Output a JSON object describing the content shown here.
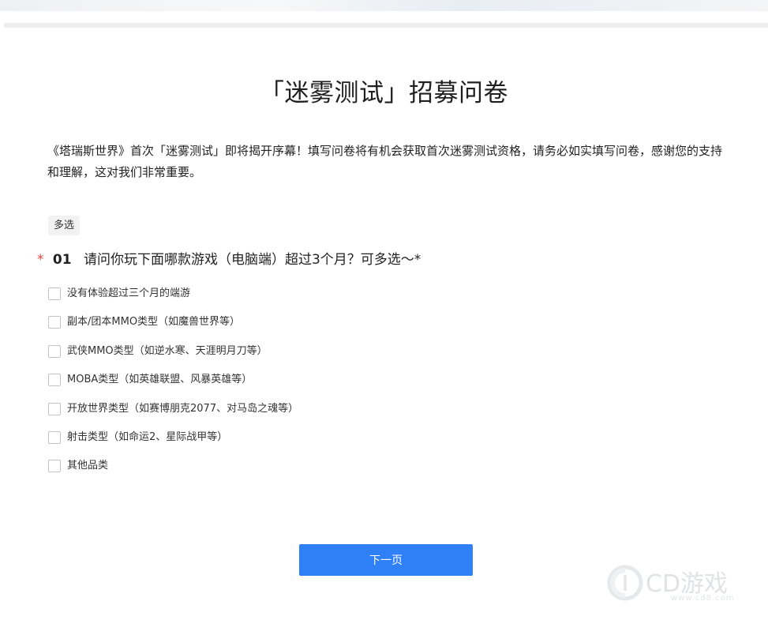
{
  "survey": {
    "title": "「迷雾测试」招募问卷",
    "intro": "《塔瑞斯世界》首次「迷雾测试」即将揭开序幕！填写问卷将有机会获取首次迷雾测试资格，请务必如实填写问卷，感谢您的支持和理解，这对我们非常重要。"
  },
  "question": {
    "type_badge": "多选",
    "required_mark": "*",
    "number": "01",
    "text": "请问你玩下面哪款游戏（电脑端）超过3个月？可多选～*",
    "options": [
      {
        "label": "没有体验超过三个月的端游",
        "checked": false
      },
      {
        "label": "副本/团本MMO类型（如魔兽世界等）",
        "checked": false
      },
      {
        "label": "武侠MMO类型（如逆水寒、天涯明月刀等）",
        "checked": false
      },
      {
        "label": "MOBA类型（如英雄联盟、风暴英雄等）",
        "checked": false
      },
      {
        "label": "开放世界类型（如赛博朋克2077、对马岛之魂等）",
        "checked": false
      },
      {
        "label": "射击类型（如命运2、星际战甲等）",
        "checked": false
      },
      {
        "label": "其他品类",
        "checked": false
      }
    ]
  },
  "actions": {
    "next_label": "下一页"
  },
  "watermark": {
    "brand": "CD游戏",
    "url": "www.cd8.com"
  },
  "colors": {
    "primary": "#2f80f7",
    "required": "#e0463a"
  }
}
